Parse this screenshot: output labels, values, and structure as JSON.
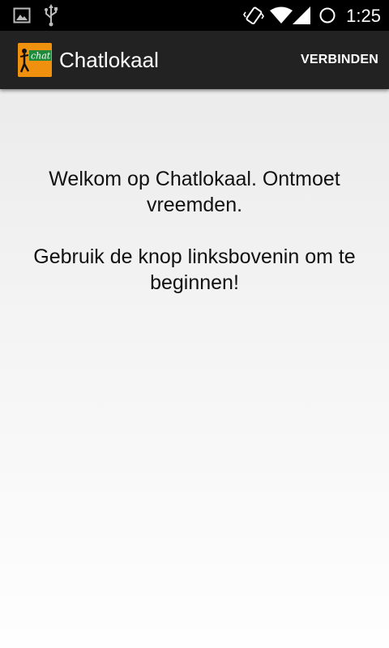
{
  "status_bar": {
    "time": "1:25",
    "icons": [
      "gallery-notification-icon",
      "usb-icon",
      "vibrate-icon",
      "wifi-icon",
      "cell-signal-icon",
      "sync-icon"
    ]
  },
  "action_bar": {
    "title": "Chatlokaal",
    "logo_text": "chat",
    "connect_label": "VERBINDEN",
    "background": "#222222",
    "logo_color": "#f0900f"
  },
  "main": {
    "welcome_text": "Welkom op Chatlokaal. Ontmoet vreemden.",
    "instruction_text": "Gebruik de knop linksbovenin om te beginnen!"
  }
}
